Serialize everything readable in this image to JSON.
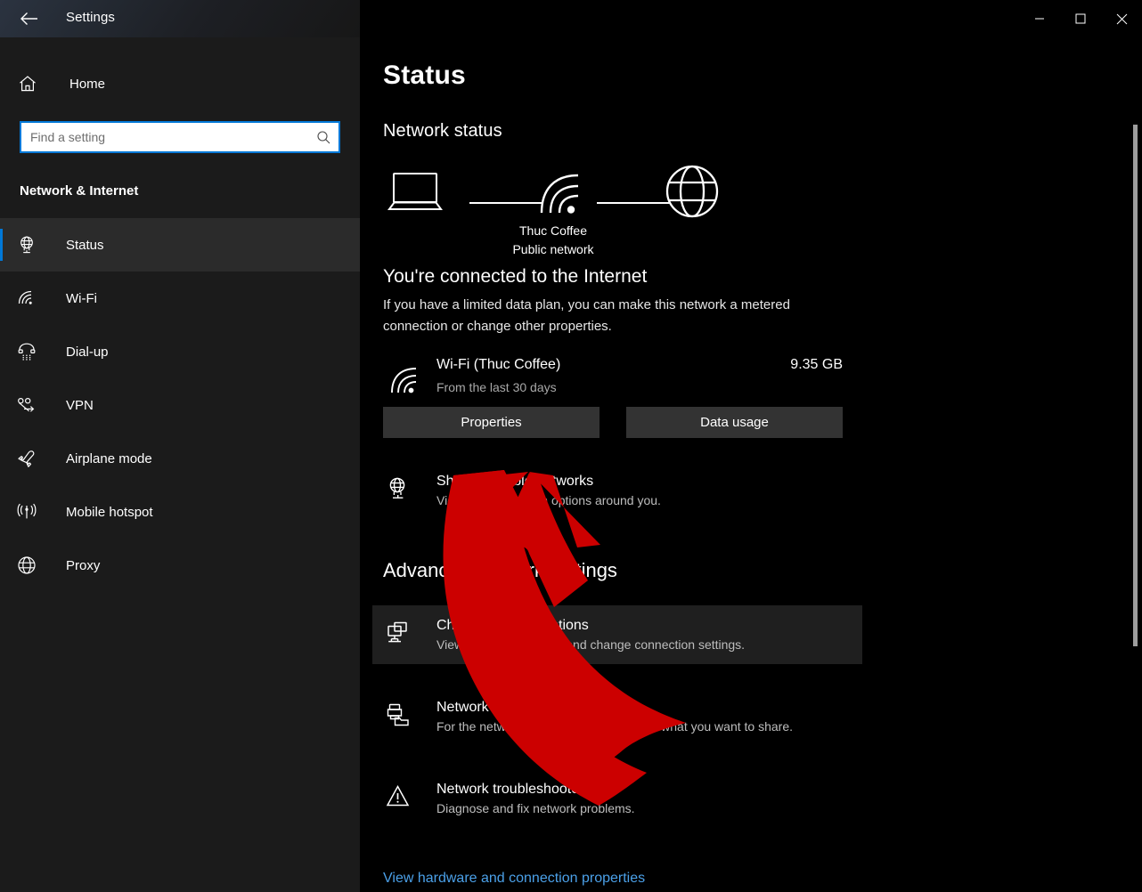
{
  "window": {
    "title": "Settings",
    "back_icon": "back-arrow-icon",
    "minimize_label": "—",
    "maximize_label": "□",
    "close_label": "✕"
  },
  "sidebar": {
    "home_label": "Home",
    "search": {
      "placeholder": "Find a setting",
      "value": "",
      "icon": "search-icon"
    },
    "section_title": "Network & Internet",
    "items": [
      {
        "label": "Status",
        "icon": "globe-monitor-icon",
        "active": true
      },
      {
        "label": "Wi-Fi",
        "icon": "wifi-icon",
        "active": false
      },
      {
        "label": "Dial-up",
        "icon": "dialup-phone-icon",
        "active": false
      },
      {
        "label": "VPN",
        "icon": "vpn-icon",
        "active": false
      },
      {
        "label": "Airplane mode",
        "icon": "airplane-icon",
        "active": false
      },
      {
        "label": "Mobile hotspot",
        "icon": "hotspot-icon",
        "active": false
      },
      {
        "label": "Proxy",
        "icon": "globe-icon",
        "active": false
      }
    ]
  },
  "main": {
    "page_title": "Status",
    "network_status_heading": "Network status",
    "diagram": {
      "device_icon": "laptop-icon",
      "network_icon": "wifi-icon",
      "internet_icon": "globe-icon",
      "network_name": "Thuc Coffee",
      "network_type": "Public network"
    },
    "connected_heading": "You're connected to the Internet",
    "connected_description": "If you have a limited data plan, you can make this network a metered connection or change other properties.",
    "usage": {
      "icon": "wifi-icon",
      "name": "Wi-Fi (Thuc Coffee)",
      "period": "From the last 30 days",
      "amount": "9.35 GB"
    },
    "buttons": {
      "properties": "Properties",
      "data_usage": "Data usage"
    },
    "show_networks": {
      "icon": "globe-monitor-icon",
      "title": "Show available networks",
      "subtitle": "View the connection options around you."
    },
    "advanced_heading": "Advanced network settings",
    "advanced_items": [
      {
        "icon": "adapter-monitor-icon",
        "title": "Change adapter options",
        "subtitle": "View network adapters and change connection settings.",
        "hovered": true
      },
      {
        "icon": "sharing-folder-icon",
        "title": "Network and Sharing Center",
        "subtitle": "For the networks you connect to, decide what you want to share.",
        "hovered": false
      },
      {
        "icon": "warning-triangle-icon",
        "title": "Network troubleshooter",
        "subtitle": "Diagnose and fix network problems.",
        "hovered": false
      }
    ],
    "link": "View hardware and connection properties"
  },
  "annotation": {
    "arrow_color": "#cc0000",
    "arrow_name": "red-curved-arrow-pointing-to-properties-button"
  },
  "colors": {
    "accent": "#0078d7",
    "sidebar_bg": "#1b1b1b",
    "main_bg": "#000000",
    "button_bg": "#333333",
    "link": "#4ba0e8",
    "arrow_red": "#cc0000"
  }
}
